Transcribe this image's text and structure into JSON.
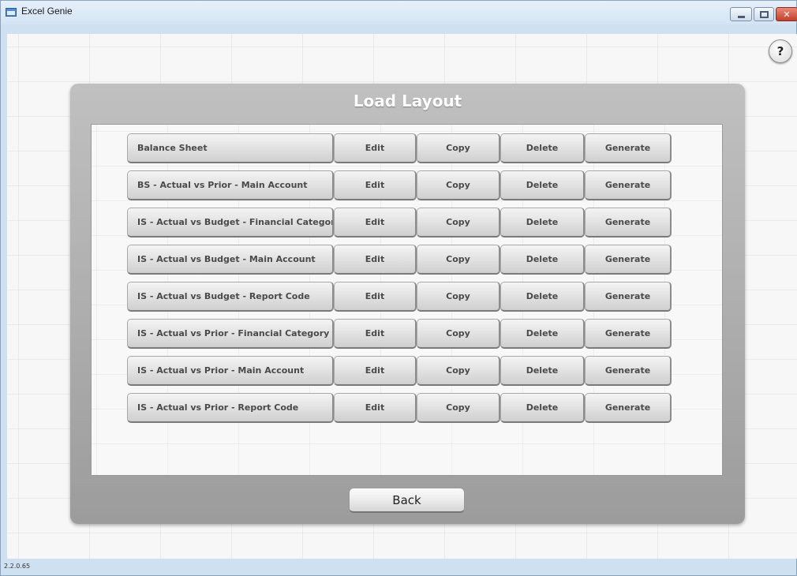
{
  "window": {
    "title": "Excel Genie",
    "close_glyph": "✕",
    "help_glyph": "?"
  },
  "panel": {
    "title": "Load Layout"
  },
  "layouts": [
    {
      "name": "Balance Sheet",
      "edit": "Edit",
      "copy": "Copy",
      "delete": "Delete",
      "generate": "Generate"
    },
    {
      "name": "BS - Actual vs Prior - Main Account",
      "edit": "Edit",
      "copy": "Copy",
      "delete": "Delete",
      "generate": "Generate"
    },
    {
      "name": "IS - Actual vs Budget - Financial Categor",
      "edit": "Edit",
      "copy": "Copy",
      "delete": "Delete",
      "generate": "Generate"
    },
    {
      "name": "IS - Actual vs Budget - Main Account",
      "edit": "Edit",
      "copy": "Copy",
      "delete": "Delete",
      "generate": "Generate"
    },
    {
      "name": "IS - Actual vs Budget - Report Code",
      "edit": "Edit",
      "copy": "Copy",
      "delete": "Delete",
      "generate": "Generate"
    },
    {
      "name": "IS - Actual vs Prior - Financial Category",
      "edit": "Edit",
      "copy": "Copy",
      "delete": "Delete",
      "generate": "Generate"
    },
    {
      "name": "IS - Actual vs Prior - Main Account",
      "edit": "Edit",
      "copy": "Copy",
      "delete": "Delete",
      "generate": "Generate"
    },
    {
      "name": "IS - Actual vs Prior - Report Code",
      "edit": "Edit",
      "copy": "Copy",
      "delete": "Delete",
      "generate": "Generate"
    }
  ],
  "footer": {
    "back_label": "Back",
    "version": "2.2.0.65"
  }
}
